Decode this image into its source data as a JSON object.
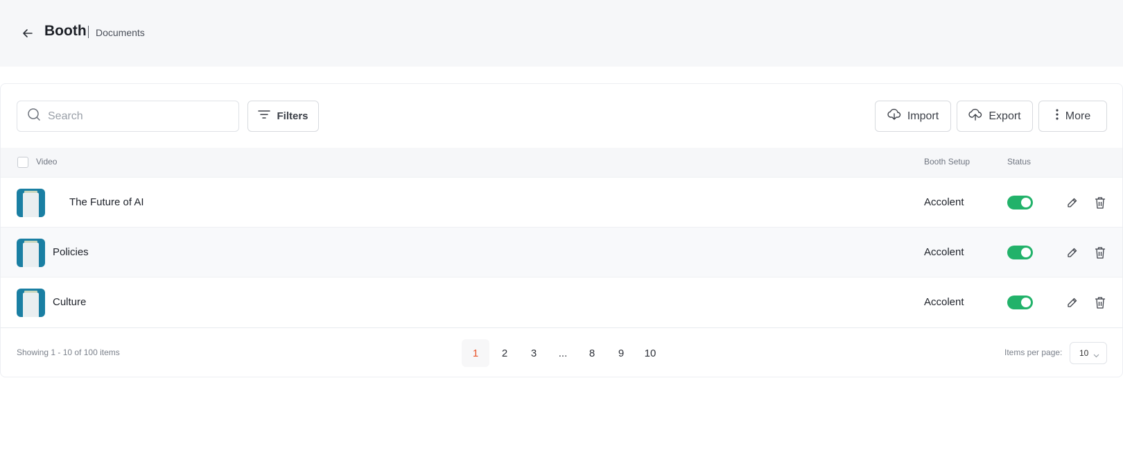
{
  "header": {
    "title": "Booth",
    "subtitle": "Documents"
  },
  "toolbar": {
    "search_placeholder": "Search",
    "filters_label": "Filters",
    "import_label": "Import",
    "export_label": "Export",
    "more_label": "More"
  },
  "table": {
    "columns": {
      "video": "Video",
      "booth_setup": "Booth Setup",
      "status": "Status"
    },
    "rows": [
      {
        "title": "The Future of AI",
        "booth_setup": "Accolent",
        "status_on": true
      },
      {
        "title": "Policies",
        "booth_setup": "Accolent",
        "status_on": true
      },
      {
        "title": "Culture",
        "booth_setup": "Accolent",
        "status_on": true
      }
    ]
  },
  "footer": {
    "showing": "Showing 1 - 10 of 100 items",
    "pages": [
      "1",
      "2",
      "3",
      "...",
      "8",
      "9",
      "10"
    ],
    "active_page": "1",
    "items_per_page_label": "Items per page:",
    "items_per_page_value": "10"
  },
  "colors": {
    "accent": "#e8542b",
    "toggle_on": "#22b26a",
    "thumbnail": "#1a7fa3"
  }
}
